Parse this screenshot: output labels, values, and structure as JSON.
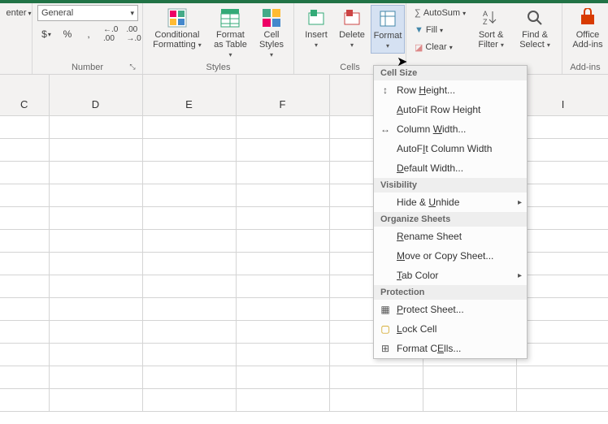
{
  "alignment": {
    "enter_label": "enter",
    "dd": "▾"
  },
  "number": {
    "group_label": "Number",
    "format_name": "General",
    "dd": "▾",
    "currency": "$",
    "percent": "%",
    "comma": ",",
    "inc_dec": ".0",
    "inc_dec2": ".00",
    "dlg_launch": "⤡"
  },
  "styles": {
    "group_label": "Styles",
    "cond_fmt": "Conditional Formatting",
    "cond_fmt_icon": "▦",
    "fmt_table": "Format as Table",
    "cell_styles": "Cell Styles",
    "dd": "▾"
  },
  "cells": {
    "group_label": "Cells",
    "insert": "Insert",
    "delete": "Delete",
    "format": "Format",
    "dd": "▾"
  },
  "editing": {
    "autosum": "AutoSum",
    "fill": "Fill",
    "clear": "Clear",
    "sort_filter": "Sort & Filter",
    "find_select": "Find & Select",
    "sigma": "∑",
    "dd": "▾"
  },
  "addins": {
    "group_label": "Add-ins",
    "office_addins": "Office Add-ins"
  },
  "format_menu": {
    "sec_cellsize": "Cell Size",
    "row_height": "Row Height...",
    "row_height_u": "H",
    "autofit_row": "AutoFit Row Height",
    "autofit_row_u": "A",
    "col_width": "Column Width...",
    "col_width_u": "W",
    "autofit_col": "AutoFit Column Width",
    "autofit_col_u": "I",
    "default_width": "Default Width...",
    "default_width_u": "D",
    "sec_visibility": "Visibility",
    "hide_unhide": "Hide & Unhide",
    "hide_unhide_u": "U",
    "sec_organize": "Organize Sheets",
    "rename": "Rename Sheet",
    "rename_u": "R",
    "movecopy": "Move or Copy Sheet...",
    "movecopy_u": "M",
    "tabcolor": "Tab Color",
    "tabcolor_u": "T",
    "sec_protection": "Protection",
    "protect": "Protect Sheet...",
    "protect_u": "P",
    "lockcell": "Lock Cell",
    "lockcell_u": "L",
    "formatcells": "Format Cells...",
    "formatcells_u": "E",
    "submenu_arrow": "▸"
  },
  "columns": [
    "C",
    "D",
    "E",
    "F",
    "",
    "",
    "I"
  ]
}
